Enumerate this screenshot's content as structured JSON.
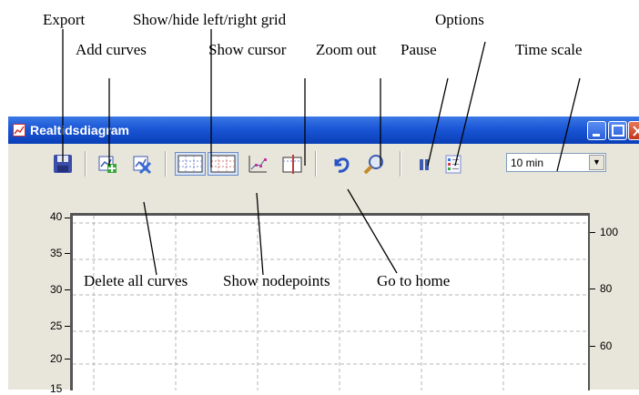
{
  "annotations": {
    "export": "Export",
    "add_curves": "Add curves",
    "show_hide_grid": "Show/hide left/right grid",
    "show_cursor": "Show cursor",
    "zoom_out": "Zoom out",
    "pause": "Pause",
    "options": "Options",
    "time_scale": "Time scale",
    "delete_all_curves": "Delete all curves",
    "show_nodepoints": "Show nodepoints",
    "go_to_home": "Go to home"
  },
  "window": {
    "title": "Realtidsdiagram"
  },
  "toolbar": {
    "time_scale_value": "10 min"
  },
  "icons": {
    "export": "floppy-disk-icon",
    "add_curves": "add-curve-icon",
    "delete_all_curves": "delete-curves-icon",
    "left_grid": "left-grid-icon",
    "right_grid": "right-grid-icon",
    "nodepoints": "nodepoints-icon",
    "cursor": "cursor-icon",
    "home": "undo-arrow-icon",
    "zoom_out": "magnifier-icon",
    "pause": "pause-icon",
    "options": "options-icon"
  },
  "plot": {
    "left_axis_ticks": [
      "40",
      "35",
      "30",
      "25",
      "20",
      "15"
    ],
    "right_axis_ticks": [
      "100",
      "80",
      "60"
    ]
  },
  "colors": {
    "titlebar": "#1a56d6",
    "window_face": "#e8e6da"
  }
}
